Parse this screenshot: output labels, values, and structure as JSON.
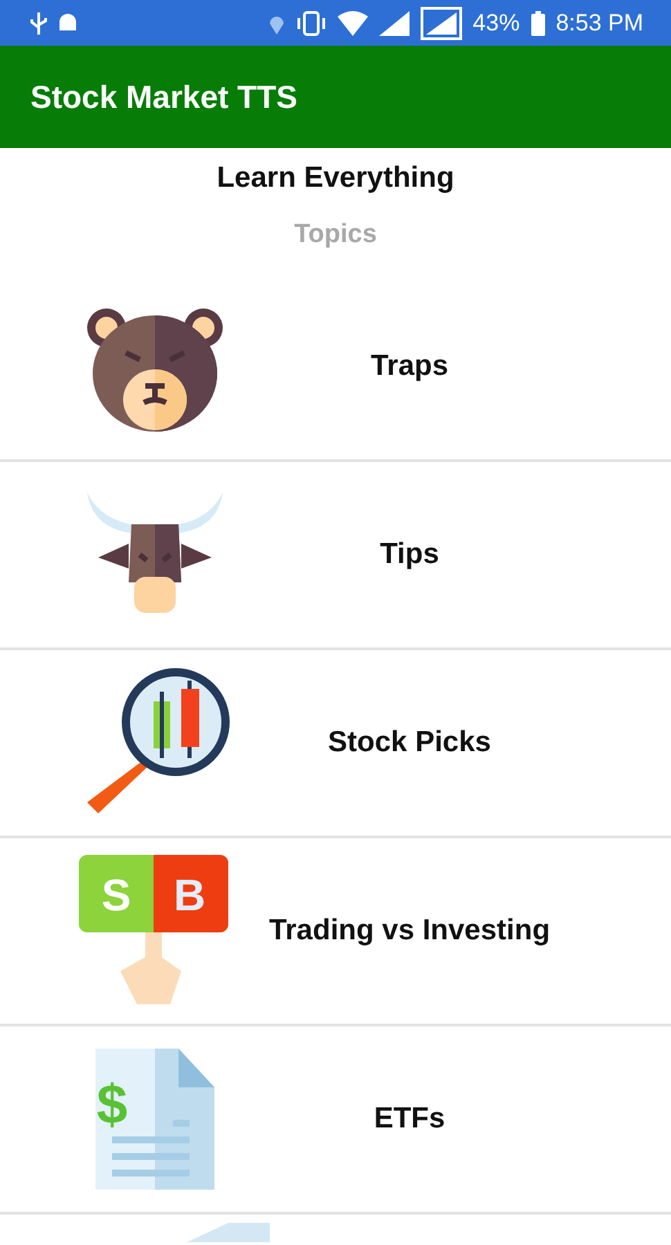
{
  "status_bar": {
    "battery": "43%",
    "time": "8:53 PM"
  },
  "app_bar": {
    "title": "Stock Market TTS"
  },
  "header": {
    "title": "Learn Everything",
    "subtitle": "Topics"
  },
  "topics": [
    {
      "kind": "bear",
      "label": "Traps"
    },
    {
      "kind": "bull",
      "label": "Tips"
    },
    {
      "kind": "magnifier",
      "label": "Stock Picks"
    },
    {
      "kind": "sell-buy",
      "label": "Trading vs Investing",
      "icon_text": [
        "S",
        "B"
      ]
    },
    {
      "kind": "document",
      "label": "ETFs",
      "icon_text": [
        "$"
      ]
    },
    {
      "kind": "partial"
    }
  ]
}
